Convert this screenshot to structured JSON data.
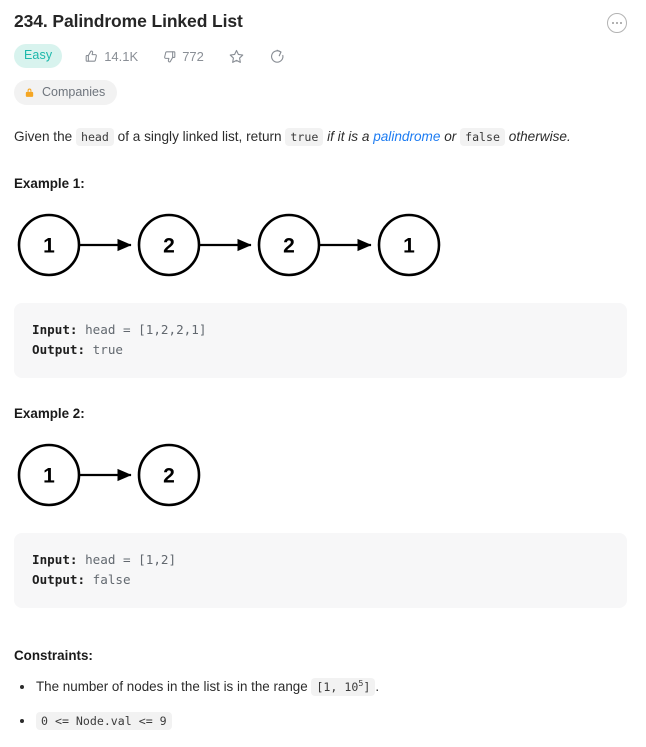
{
  "header": {
    "title": "234. Palindrome Linked List",
    "more_icon": "ellipsis-icon",
    "difficulty": "Easy",
    "likes": "14.1K",
    "dislikes": "772",
    "favorite_icon": "star-icon",
    "share_icon": "share-icon",
    "thumbs_up_icon": "thumbs-up-icon",
    "thumbs_down_icon": "thumbs-down-icon"
  },
  "tags": {
    "companies_label": "Companies",
    "lock_icon": "lock-icon"
  },
  "description": {
    "part1": "Given the ",
    "code_head": "head",
    "part2": " of a singly linked list, return ",
    "code_true": "true",
    "part3": " if it is a ",
    "link_palindrome": "palindrome",
    "part4": " or ",
    "code_false": "false",
    "part5": " otherwise."
  },
  "examples": [
    {
      "heading": "Example 1:",
      "nodes": [
        "1",
        "2",
        "2",
        "1"
      ],
      "input_label": "Input:",
      "input_value": " head = [1,2,2,1]",
      "output_label": "Output:",
      "output_value": " true"
    },
    {
      "heading": "Example 2:",
      "nodes": [
        "1",
        "2"
      ],
      "input_label": "Input:",
      "input_value": " head = [1,2]",
      "output_label": "Output:",
      "output_value": " false"
    }
  ],
  "constraints": {
    "heading": "Constraints:",
    "item1_text": "The number of nodes in the list is in the range ",
    "item1_code_prefix": "[1, 10",
    "item1_code_sup": "5",
    "item1_code_suffix": "]",
    "item1_suffix": ".",
    "item2_code": "0 <= Node.val <= 9"
  },
  "colors": {
    "easy_bg": "#d8f3ee",
    "easy_text": "#1cb8ab",
    "link": "#1d7cf2",
    "lock": "#f5a623",
    "code_bg": "#f7f7f8",
    "muted": "#8a8f96"
  }
}
